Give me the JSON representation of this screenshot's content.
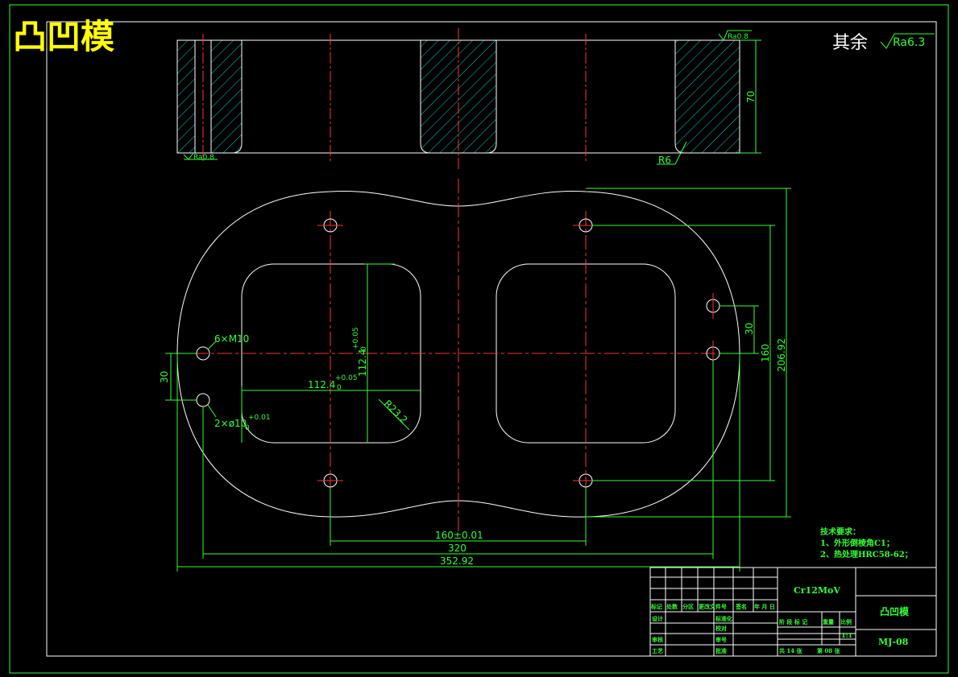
{
  "title": "凸凹模",
  "surface_finish": {
    "rest_label": "其余",
    "rest_value": "Ra6.3",
    "top_value": "Ra0.8",
    "bottom_value": "Ra0.8"
  },
  "section_view": {
    "height_dim": "70",
    "radius": "R6"
  },
  "plan_view": {
    "hole_callout_threaded": "6×M10",
    "hole_callout_pin": "2×ø10",
    "pin_tolerance": "+0.01",
    "pin_tolerance_sub": "0",
    "opening_width": "112.4",
    "opening_width_tol": "+0.05",
    "opening_width_sub": "0",
    "opening_height": "112.4",
    "opening_height_tol": "+0.05",
    "opening_height_sub": "0",
    "corner_radius": "R23.2",
    "dim_left_30": "30",
    "dim_right_30": "30",
    "dim_160_v": "160",
    "dim_206": "206.92",
    "dim_160_h": "160±0.01",
    "dim_320": "320",
    "dim_352": "352.92"
  },
  "tech_notes": {
    "heading": "技术要求：",
    "line1": "1、外形倒棱角C1；",
    "line2": "2、热处理HRC58-62；"
  },
  "title_block": {
    "material": "Cr12MoV",
    "part_name": "凸凹模",
    "drawing_no": "MJ-08",
    "scale": "1:1",
    "header_row": [
      "标记",
      "处数",
      "分区",
      "更改文件号",
      "签名",
      "年 月 日"
    ],
    "row_design": "设计",
    "row_standard": "标准化",
    "row_review": "审核",
    "row_craft": "工艺",
    "row_proof": "校对",
    "row_approve": "批准",
    "row_count": "审号",
    "stage_header": [
      "阶 段 标 记",
      "重量",
      "比例"
    ],
    "sheets": "共 14 张",
    "sheet_no": "第 08 张"
  }
}
